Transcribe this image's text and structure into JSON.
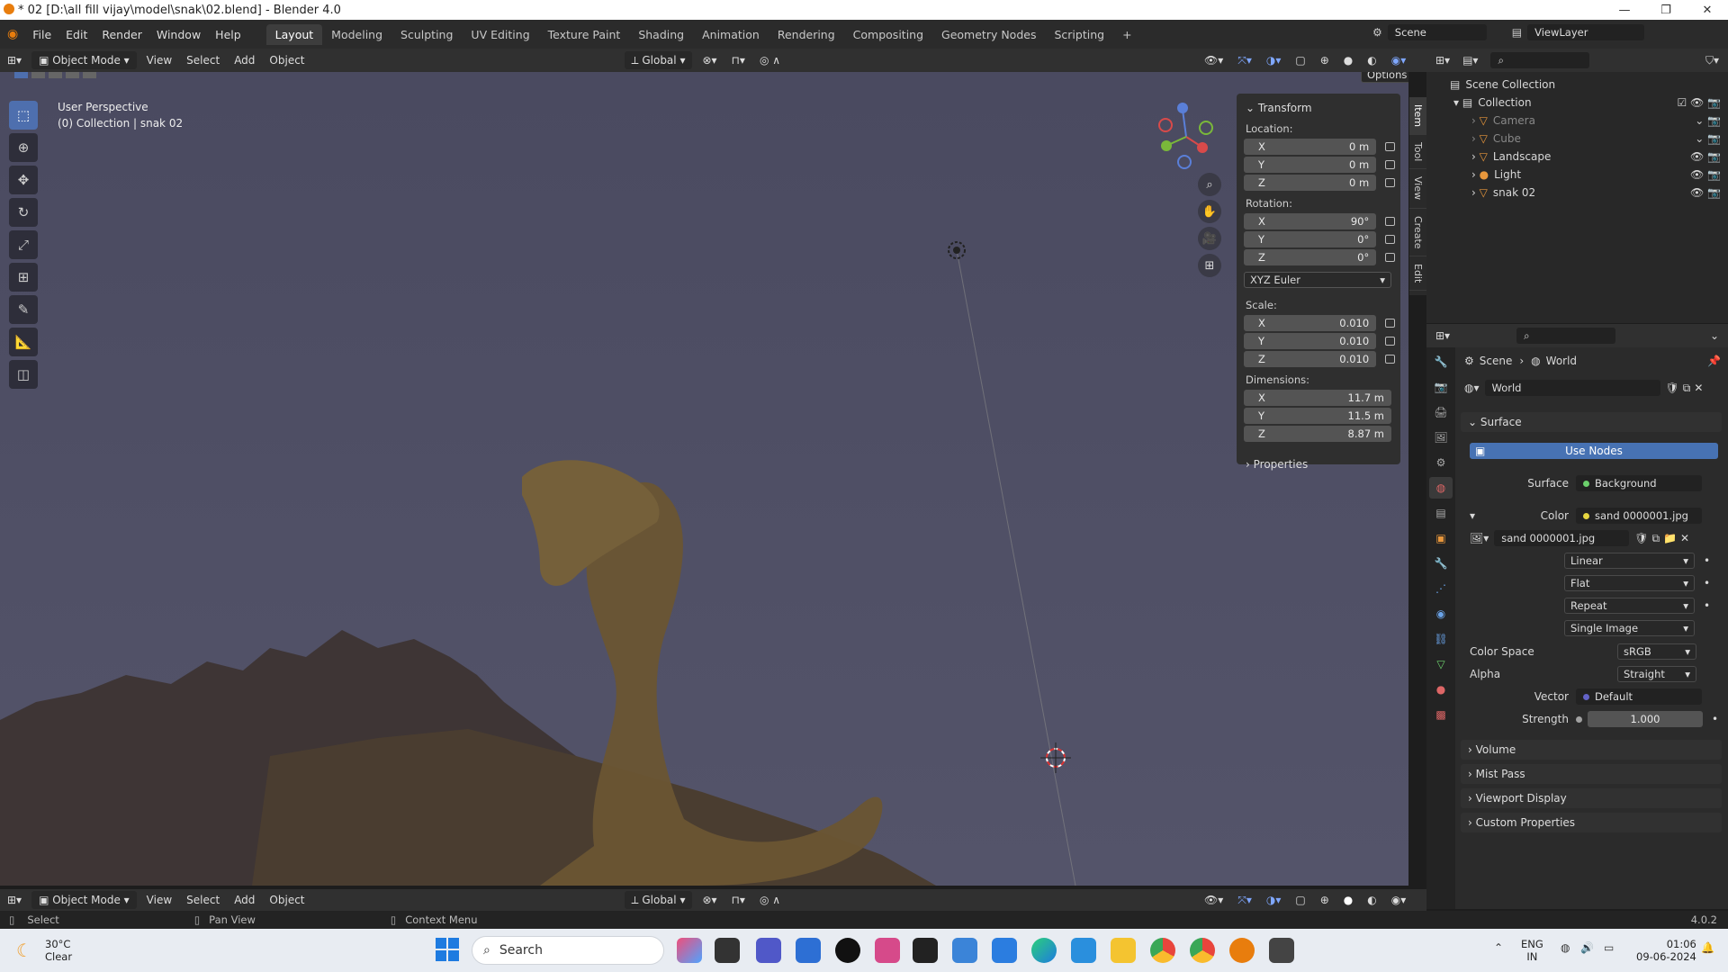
{
  "window": {
    "title": "* 02 [D:\\all fill vijay\\model\\snak\\02.blend] - Blender 4.0"
  },
  "menu": [
    "File",
    "Edit",
    "Render",
    "Window",
    "Help"
  ],
  "workspaces": [
    "Layout",
    "Modeling",
    "Sculpting",
    "UV Editing",
    "Texture Paint",
    "Shading",
    "Animation",
    "Rendering",
    "Compositing",
    "Geometry Nodes",
    "Scripting",
    "+"
  ],
  "scene": {
    "label": "Scene",
    "view_layer": "ViewLayer"
  },
  "header": {
    "mode": "Object Mode",
    "view": "View",
    "select": "Select",
    "add": "Add",
    "object": "Object",
    "orientation": "Global",
    "options": "Options"
  },
  "viewport": {
    "perspective": "User Perspective",
    "collection": "(0) Collection | snak 02"
  },
  "transform": {
    "title": "Transform",
    "location_label": "Location:",
    "location": [
      {
        "axis": "X",
        "value": "0 m"
      },
      {
        "axis": "Y",
        "value": "0 m"
      },
      {
        "axis": "Z",
        "value": "0 m"
      }
    ],
    "rotation_label": "Rotation:",
    "rotation": [
      {
        "axis": "X",
        "value": "90°"
      },
      {
        "axis": "Y",
        "value": "0°"
      },
      {
        "axis": "Z",
        "value": "0°"
      }
    ],
    "rotation_mode": "XYZ Euler",
    "scale_label": "Scale:",
    "scale": [
      {
        "axis": "X",
        "value": "0.010"
      },
      {
        "axis": "Y",
        "value": "0.010"
      },
      {
        "axis": "Z",
        "value": "0.010"
      }
    ],
    "dimensions_label": "Dimensions:",
    "dimensions": [
      {
        "axis": "X",
        "value": "11.7 m"
      },
      {
        "axis": "Y",
        "value": "11.5 m"
      },
      {
        "axis": "Z",
        "value": "8.87 m"
      }
    ],
    "properties": "Properties"
  },
  "side_tabs": [
    "Item",
    "Tool",
    "View",
    "Create",
    "Edit"
  ],
  "outliner": {
    "root": "Scene Collection",
    "collection": "Collection",
    "items": [
      "Camera",
      "Cube",
      "Landscape",
      "Light",
      "snak 02"
    ]
  },
  "properties": {
    "breadcrumb_scene": "Scene",
    "breadcrumb_world": "World",
    "world_name": "World",
    "surface_section": "Surface",
    "use_nodes": "Use Nodes",
    "surface_label": "Surface",
    "surface_value": "Background",
    "color_label": "Color",
    "color_value": "sand 0000001.jpg",
    "image_name": "sand 0000001.jpg",
    "interpolation": "Linear",
    "projection": "Flat",
    "extension": "Repeat",
    "source": "Single Image",
    "color_space_label": "Color Space",
    "color_space": "sRGB",
    "alpha_label": "Alpha",
    "alpha": "Straight",
    "vector_label": "Vector",
    "vector": "Default",
    "strength_label": "Strength",
    "strength": "1.000",
    "sections": [
      "Volume",
      "Mist Pass",
      "Viewport Display",
      "Custom Properties"
    ]
  },
  "status": {
    "select": "Select",
    "pan": "Pan View",
    "context": "Context Menu",
    "version": "4.0.2"
  },
  "taskbar": {
    "temp": "30°C",
    "weather": "Clear",
    "search": "Search",
    "lang1": "ENG",
    "lang2": "IN",
    "time": "01:06",
    "date": "09-06-2024"
  }
}
